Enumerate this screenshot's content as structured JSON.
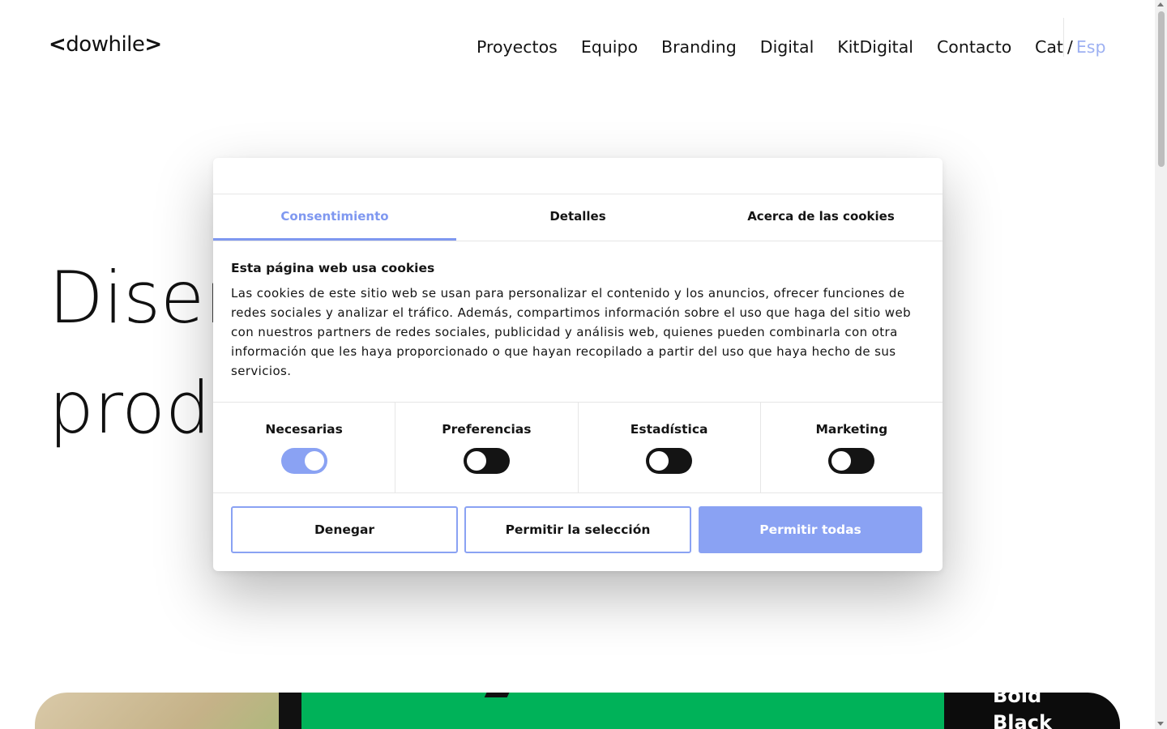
{
  "header": {
    "logo": {
      "open": "<",
      "name": "dowhile",
      "close": ">"
    },
    "nav": [
      "Proyectos",
      "Equipo",
      "Branding",
      "Digital",
      "KitDigital",
      "Contacto"
    ],
    "lang": {
      "cat": "Cat",
      "sep": "/",
      "esp": "Esp",
      "active_color": "#9db0f2"
    }
  },
  "hero": {
    "line1": "Diseñ",
    "line2": "produ"
  },
  "strip": {
    "text_line1": "Bold",
    "text_line2": "Black"
  },
  "cookie_dialog": {
    "tabs": [
      "Consentimiento",
      "Detalles",
      "Acerca de las cookies"
    ],
    "active_tab": 0,
    "title": "Esta página web usa cookies",
    "description": "Las cookies de este sitio web se usan para personalizar el contenido y los anuncios, ofrecer funciones de redes sociales y analizar el tráfico. Además, compartimos información sobre el uso que haga del sitio web con nuestros partners de redes sociales, publicidad y análisis web, quienes pueden combinarla con otra información que les haya proporcionado o que hayan recopilado a partir del uso que haya hecho de sus servicios.",
    "categories": [
      {
        "label": "Necesarias",
        "enabled": true
      },
      {
        "label": "Preferencias",
        "enabled": false
      },
      {
        "label": "Estadística",
        "enabled": false
      },
      {
        "label": "Marketing",
        "enabled": false
      }
    ],
    "buttons": {
      "deny": "Denegar",
      "allow_selection": "Permitir la selección",
      "allow_all": "Permitir todas"
    },
    "accent_color": "#8aa2f3"
  }
}
